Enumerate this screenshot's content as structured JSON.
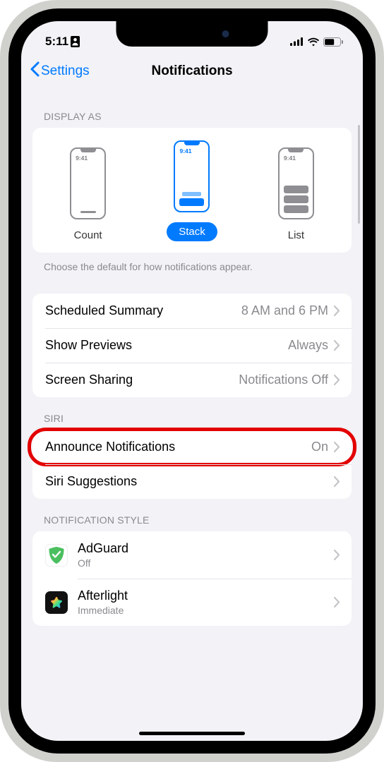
{
  "status": {
    "time": "5:11",
    "id_card": true
  },
  "nav": {
    "back": "Settings",
    "title": "Notifications"
  },
  "display_as": {
    "header": "Display As",
    "modes": {
      "count": "Count",
      "stack": "Stack",
      "list": "List",
      "mini_time": "9:41"
    },
    "footer": "Choose the default for how notifications appear."
  },
  "settings_rows": {
    "scheduled_summary": {
      "label": "Scheduled Summary",
      "value": "8 AM and 6 PM"
    },
    "show_previews": {
      "label": "Show Previews",
      "value": "Always"
    },
    "screen_sharing": {
      "label": "Screen Sharing",
      "value": "Notifications Off"
    }
  },
  "siri": {
    "header": "Siri",
    "announce": {
      "label": "Announce Notifications",
      "value": "On"
    },
    "suggestions": {
      "label": "Siri Suggestions"
    }
  },
  "notification_style": {
    "header": "Notification Style",
    "apps": [
      {
        "name": "AdGuard",
        "status": "Off"
      },
      {
        "name": "Afterlight",
        "status": "Immediate"
      }
    ]
  }
}
